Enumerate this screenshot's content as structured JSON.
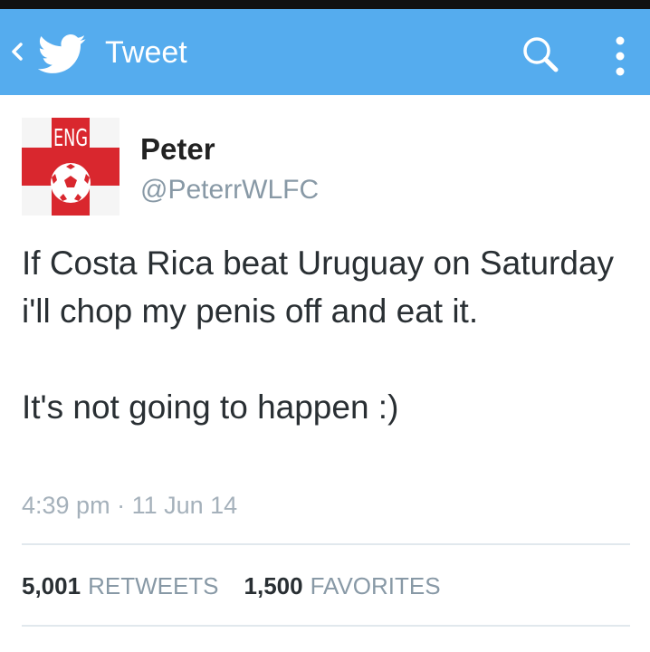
{
  "app_bar": {
    "title": "Tweet",
    "back_icon": "chevron-left-icon",
    "logo_icon": "twitter-bird-icon",
    "search_icon": "search-icon",
    "menu_icon": "overflow-menu-icon",
    "color": "#55acee"
  },
  "tweet": {
    "avatar_text": "ENG",
    "author_name": "Peter",
    "author_handle": "@PeterrWLFC",
    "text": "If Costa Rica beat Uruguay on Saturday i'll chop my penis off and eat it.\n\nIt's not going to happen :)",
    "time": "4:39 pm",
    "separator": " · ",
    "date": "11 Jun 14"
  },
  "stats": {
    "retweets_count": "5,001",
    "retweets_label": "RETWEETS",
    "favorites_count": "1,500",
    "favorites_label": "FAVORITES"
  }
}
